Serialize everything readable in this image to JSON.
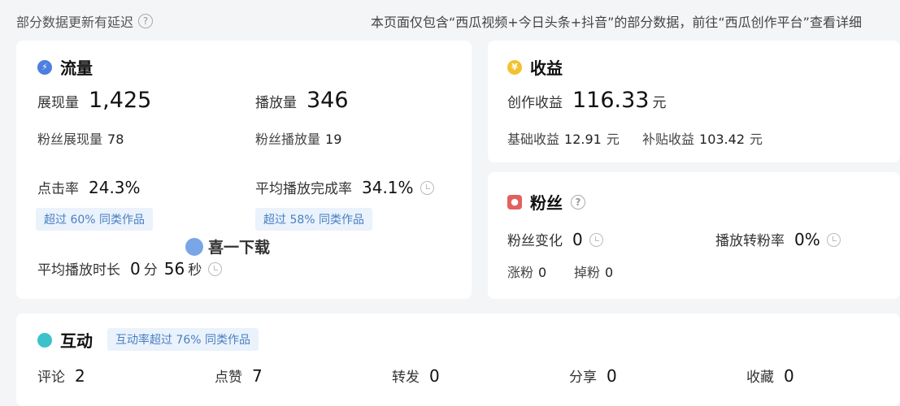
{
  "top": {
    "delay_note": "部分数据更新有延迟",
    "right_note": "本页面仅包含“西瓜视频+今日头条+抖音”的部分数据，前往“西瓜创作平台”查看详细"
  },
  "traffic": {
    "title": "流量",
    "impressions_label": "展现量",
    "impressions_value": "1,425",
    "plays_label": "播放量",
    "plays_value": "346",
    "fan_impressions_label": "粉丝展现量",
    "fan_impressions_value": "78",
    "fan_plays_label": "粉丝播放量",
    "fan_plays_value": "19",
    "ctr_label": "点击率",
    "ctr_value": "24.3%",
    "ctr_tag": "超过 60% 同类作品",
    "completion_label": "平均播放完成率",
    "completion_value": "34.1%",
    "completion_tag": "超过 58% 同类作品",
    "avg_duration_label": "平均播放时长",
    "avg_min": "0",
    "min_unit": "分",
    "avg_sec": "56",
    "sec_unit": "秒"
  },
  "revenue": {
    "title": "收益",
    "creation_label": "创作收益",
    "creation_value": "116.33",
    "currency": "元",
    "base_label": "基础收益",
    "base_value": "12.91",
    "subsidy_label": "补贴收益",
    "subsidy_value": "103.42"
  },
  "fans": {
    "title": "粉丝",
    "change_label": "粉丝变化",
    "change_value": "0",
    "conversion_label": "播放转粉率",
    "conversion_value": "0%",
    "gain_label": "涨粉",
    "gain_value": "0",
    "loss_label": "掉粉",
    "loss_value": "0"
  },
  "interaction": {
    "title": "互动",
    "tag": "互动率超过 76% 同类作品",
    "items": [
      {
        "label": "评论",
        "value": "2"
      },
      {
        "label": "点赞",
        "value": "7"
      },
      {
        "label": "转发",
        "value": "0"
      },
      {
        "label": "分享",
        "value": "0"
      },
      {
        "label": "收藏",
        "value": "0"
      }
    ]
  },
  "watermark": {
    "text": "喜一下载"
  },
  "colors": {
    "traffic_icon": "#4c7fe0",
    "revenue_icon": "#f2c230",
    "fans_icon": "#e26060",
    "interaction_icon": "#3cc2c8",
    "tag_bg": "#eaf2fc",
    "tag_text": "#4a7fc1"
  }
}
